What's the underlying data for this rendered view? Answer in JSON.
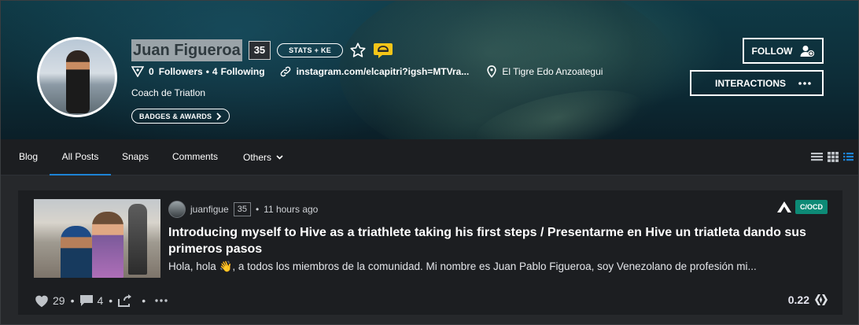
{
  "profile": {
    "name": "Juan Figueroa",
    "reputation": "35",
    "stats_label": "STATS + KE",
    "followers_count": "0",
    "followers_label": "Followers",
    "following_count": "4",
    "following_label": "Following",
    "website": "instagram.com/elcapitri?igsh=MTVra...",
    "location": "El Tigre Edo Anzoategui",
    "about": "Coach de Triatlon",
    "badges_label": "BADGES & AWARDS",
    "follow_label": "FOLLOW",
    "interactions_label": "INTERACTIONS",
    "middot": "•"
  },
  "tabs": [
    {
      "label": "Blog"
    },
    {
      "label": "All Posts"
    },
    {
      "label": "Snaps"
    },
    {
      "label": "Comments"
    },
    {
      "label": "Others"
    }
  ],
  "post": {
    "author": "juanfigue",
    "author_reputation": "35",
    "time": "11 hours ago",
    "community_tag": "C/OCD",
    "title": "Introducing myself to Hive as a triathlete taking his first steps / Presentarme en Hive un triatleta dando sus primeros pasos",
    "summary": "Hola, hola 👋, a todos los miembros de la comunidad. Mi nombre es Juan Pablo Figueroa, soy Venezolano de profesión mi...",
    "likes": "29",
    "comments": "4",
    "payout": "0.22"
  },
  "colors": {
    "accent": "#1d83d6",
    "community": "#0d8a76",
    "card_bg": "#1c1e21",
    "page_bg": "#26282b"
  },
  "icons": [
    "star-icon",
    "hat-badge-icon",
    "followers-icon",
    "link-icon",
    "location-pin-icon",
    "add-user-icon",
    "more-dots-icon",
    "chevron-right-icon",
    "chevron-down-icon",
    "list-view-icon",
    "grid-view-icon",
    "compact-view-icon",
    "heart-icon",
    "comment-icon",
    "reblog-icon",
    "hive-icon",
    "community-logo-icon"
  ]
}
